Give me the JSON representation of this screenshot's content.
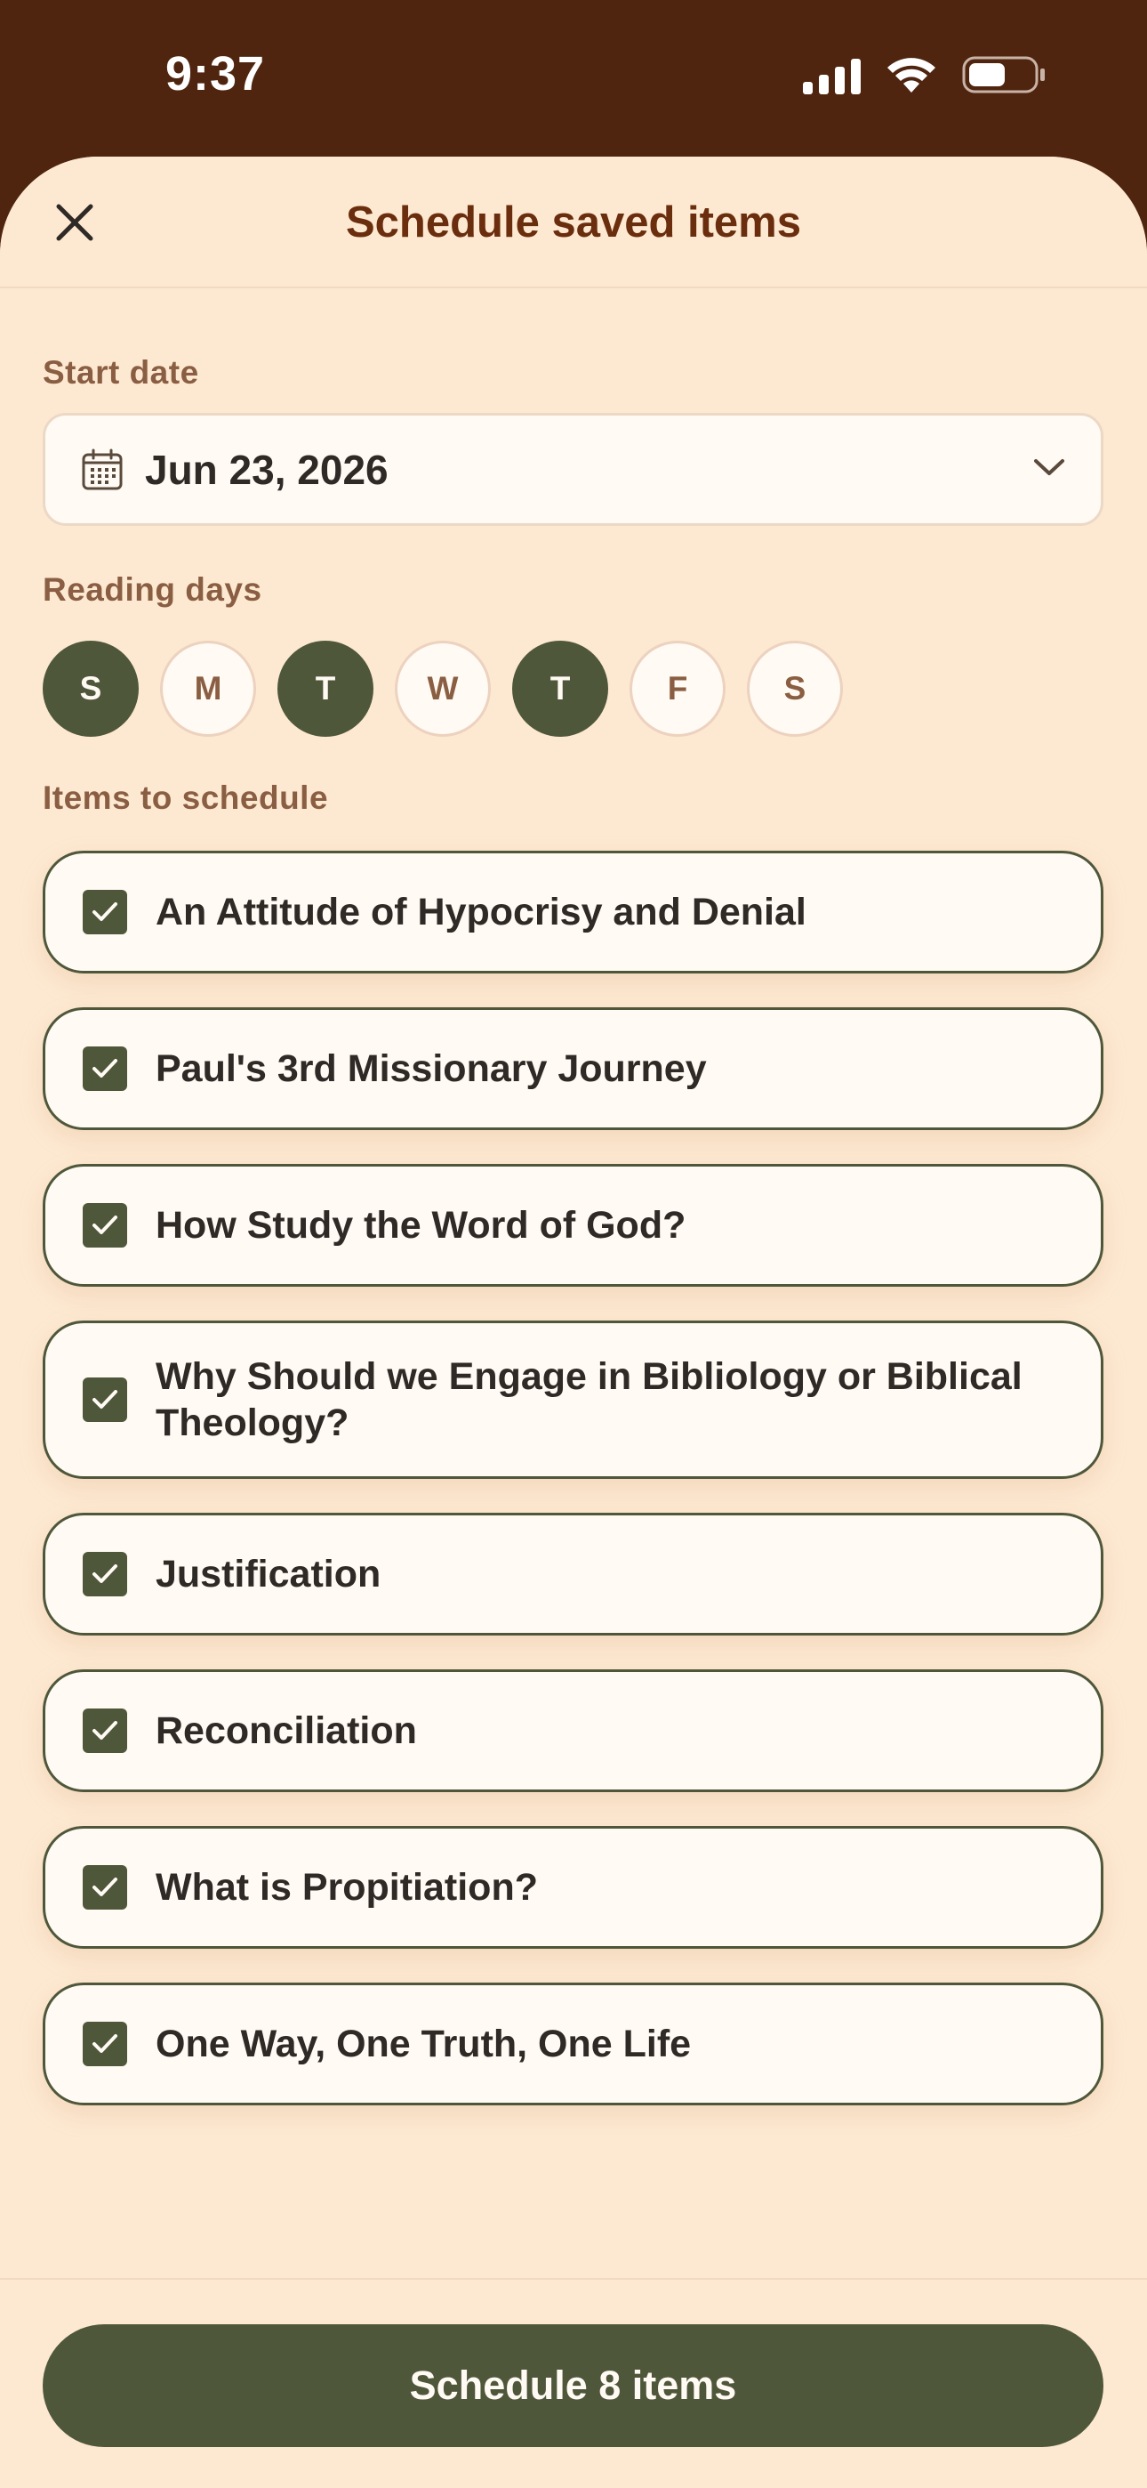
{
  "status_bar": {
    "time": "9:37"
  },
  "header": {
    "title": "Schedule saved items"
  },
  "start_date": {
    "label": "Start date",
    "value": "Jun 23, 2026"
  },
  "reading_days": {
    "label": "Reading days",
    "days": [
      {
        "letter": "S",
        "selected": true
      },
      {
        "letter": "M",
        "selected": false
      },
      {
        "letter": "T",
        "selected": true
      },
      {
        "letter": "W",
        "selected": false
      },
      {
        "letter": "T",
        "selected": true
      },
      {
        "letter": "F",
        "selected": false
      },
      {
        "letter": "S",
        "selected": false
      }
    ]
  },
  "items_section": {
    "label": "Items to schedule",
    "items": [
      {
        "title": "An Attitude of Hypocrisy and Denial",
        "checked": true
      },
      {
        "title": "Paul's 3rd Missionary Journey",
        "checked": true
      },
      {
        "title": "How Study the Word of God?",
        "checked": true
      },
      {
        "title": "Why Should we Engage in Bibliology or Biblical Theology?",
        "checked": true
      },
      {
        "title": "Justification",
        "checked": true
      },
      {
        "title": "Reconciliation",
        "checked": true
      },
      {
        "title": "What is Propitiation?",
        "checked": true
      },
      {
        "title": "One Way, One Truth, One Life",
        "checked": true
      }
    ]
  },
  "footer": {
    "button_label": "Schedule 8 items"
  },
  "colors": {
    "header_bg": "#4f250f",
    "sheet_bg": "#fde9d2",
    "accent_green": "#4f573a",
    "title_brown": "#6a2d0d",
    "label_brown": "#8a5e42"
  },
  "icons": {
    "close": "close-icon",
    "calendar": "calendar-icon",
    "dropdown": "chevron-down-icon",
    "checkbox": "checkmark-icon"
  }
}
